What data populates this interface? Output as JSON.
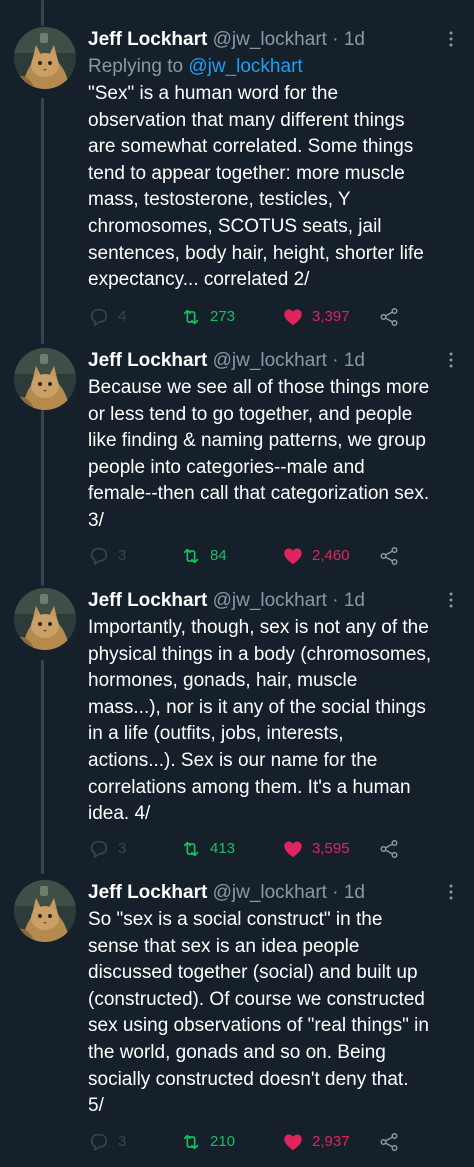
{
  "colors": {
    "background": "#15202b",
    "muted_text": "#8899a6",
    "link_blue": "#1da1f2",
    "retweet_green": "#17bf63",
    "like_pink": "#e0245e",
    "thread_line": "#38444d"
  },
  "tweets": [
    {
      "name": "Jeff Lockhart",
      "handle": "@jw_lockhart",
      "separator": "·",
      "time": "1d",
      "replying_label": "Replying to",
      "replying_to": "@jw_lockhart",
      "text": "\"Sex\" is a human word for the\nobservation that many different things\nare somewhat correlated. Some things\ntend to appear together: more muscle\nmass, testosterone, testicles, Y\nchromosomes, SCOTUS seats, jail\nsentences, body hair, height, shorter life\nexpectancy... correlated 2/",
      "replies": "4",
      "retweets": "273",
      "likes": "3,397",
      "icons": [
        "avatar",
        "more-icon",
        "reply-icon",
        "retweet-icon",
        "heart-icon",
        "share-icon"
      ]
    },
    {
      "name": "Jeff Lockhart",
      "handle": "@jw_lockhart",
      "separator": "·",
      "time": "1d",
      "text": "Because we see all of those things more\nor less tend to go together, and people\nlike finding & naming patterns, we group\npeople into categories--male and\nfemale--then call that categorization sex.\n3/",
      "replies": "3",
      "retweets": "84",
      "likes": "2,460"
    },
    {
      "name": "Jeff Lockhart",
      "handle": "@jw_lockhart",
      "separator": "·",
      "time": "1d",
      "text": "Importantly, though, sex is not any of the\nphysical things in a body (chromosomes,\nhormones, gonads, hair, muscle\nmass...), nor is it any of the social things\nin a life (outfits, jobs, interests,\nactions...). Sex is our name for the\ncorrelations among them. It's a human\nidea. 4/",
      "replies": "3",
      "retweets": "413",
      "likes": "3,595"
    },
    {
      "name": "Jeff Lockhart",
      "handle": "@jw_lockhart",
      "separator": "·",
      "time": "1d",
      "text": "So \"sex is a social construct\" in the\nsense that sex is an idea people\ndiscussed together (social) and built up\n(constructed). Of course we constructed\nsex using observations of \"real things\" in\nthe world, gonads and so on. Being\nsocially constructed doesn't deny that.\n5/",
      "replies": "3",
      "retweets": "210",
      "likes": "2,937"
    }
  ]
}
